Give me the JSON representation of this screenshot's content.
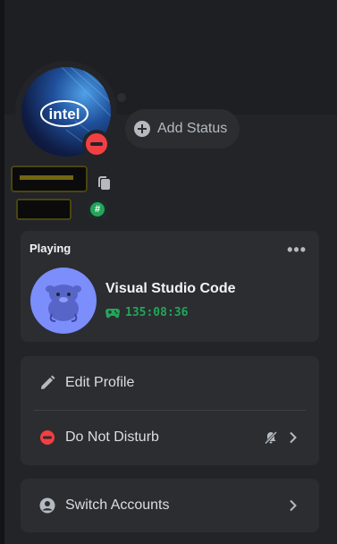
{
  "profile": {
    "add_status_label": "Add Status",
    "status": "Do Not Disturb",
    "avatar_text": "intel"
  },
  "activity": {
    "header": "Playing",
    "more_label": "•••",
    "app_name": "Visual Studio Code",
    "elapsed": "135:08:36"
  },
  "menu": {
    "edit_profile": "Edit Profile",
    "do_not_disturb": "Do Not Disturb",
    "switch_accounts": "Switch Accounts"
  },
  "colors": {
    "background": "#232428",
    "card": "#2b2d31",
    "dnd_red": "#f23f43",
    "online_green": "#23a55a",
    "activity_blurple": "#7c8dfc"
  }
}
